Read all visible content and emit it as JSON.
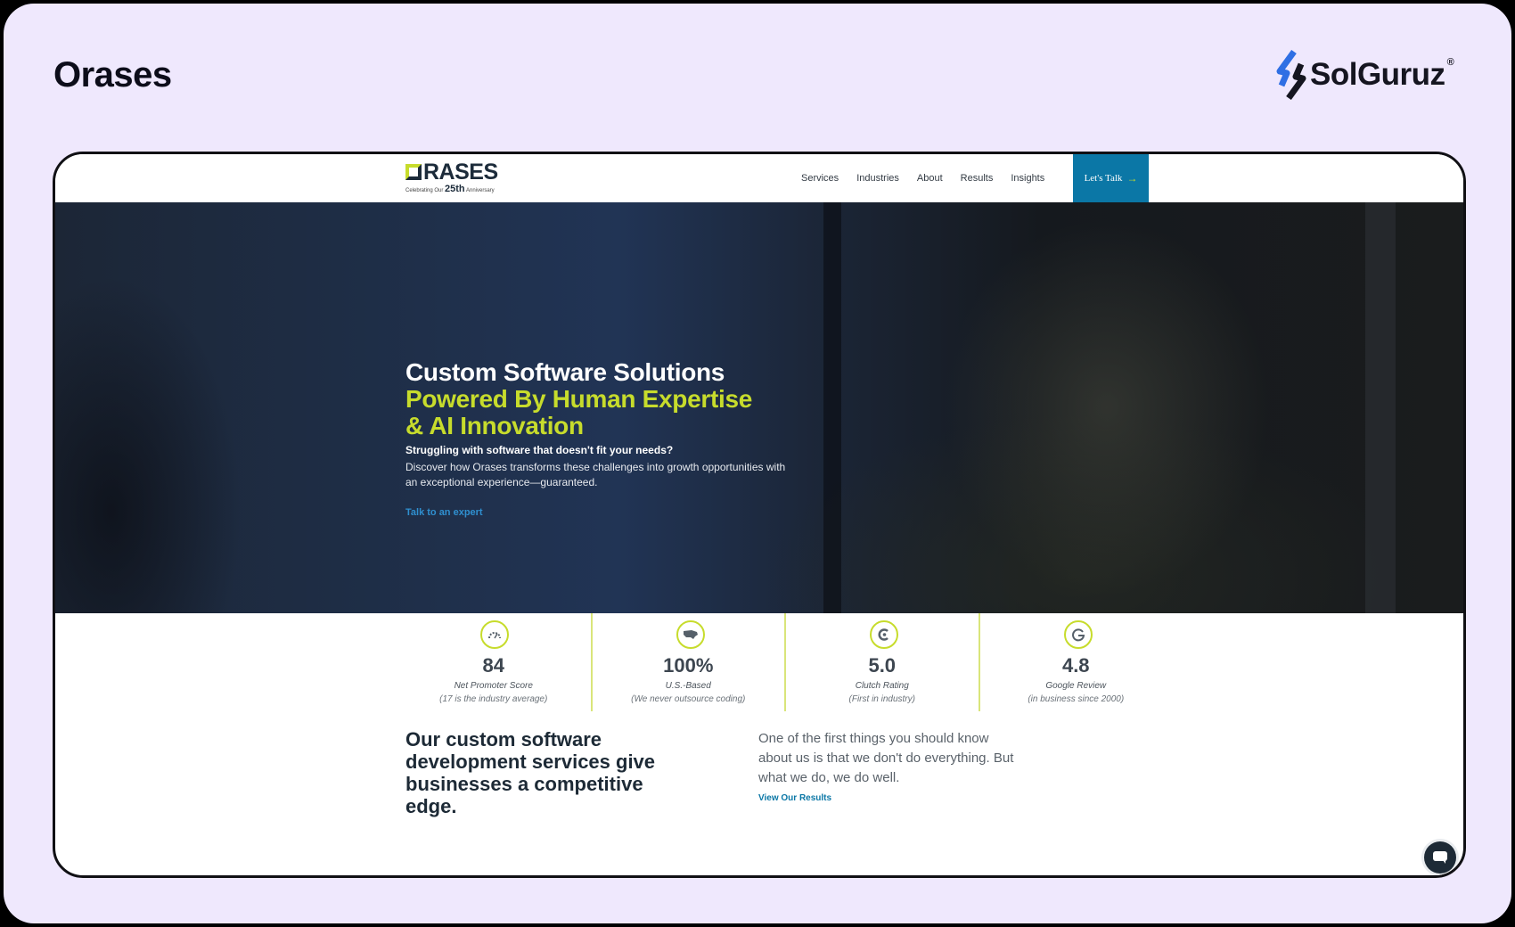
{
  "page": {
    "title": "Orases",
    "brand": {
      "name": "SolGuruz",
      "registered": "®"
    }
  },
  "site": {
    "logo": {
      "word": "RASES",
      "sub_prefix": "Celebrating Our",
      "sub_number": "25th",
      "sub_suffix": "Anniversary"
    },
    "nav": [
      {
        "label": "Services"
      },
      {
        "label": "Industries"
      },
      {
        "label": "About"
      },
      {
        "label": "Results"
      },
      {
        "label": "Insights"
      }
    ],
    "cta": {
      "label": "Let's Talk",
      "icon": "arrow-right-icon"
    }
  },
  "hero": {
    "heading_line1": "Custom Software Solutions",
    "heading_line2": "Powered By Human Expertise",
    "heading_line3": "& AI Innovation",
    "subheading": "Struggling with software that doesn't fit your needs?",
    "body": "Discover how Orases transforms these challenges into growth opportunities with an exceptional experience—guaranteed.",
    "link": "Talk to an expert"
  },
  "stats": [
    {
      "value": "84",
      "label": "Net Promoter Score",
      "note": "(17 is the industry average)",
      "icon": "gauge-icon"
    },
    {
      "value": "100%",
      "label": "U.S.-Based",
      "note": "(We never outsource coding)",
      "icon": "usa-map-icon"
    },
    {
      "value": "5.0",
      "label": "Clutch Rating",
      "note": "(First in industry)",
      "icon": "clutch-icon"
    },
    {
      "value": "4.8",
      "label": "Google Review",
      "note": "(in business since 2000)",
      "icon": "google-icon"
    }
  ],
  "services": {
    "heading": "Our custom software development services give businesses a competitive edge.",
    "text": "One of the first things you should know about us is that we don't do everything. But what we do, we do well.",
    "link": "View Our Results"
  },
  "colors": {
    "accent_lime": "#c7dc2c",
    "accent_blue": "#0b77a6",
    "frame_bg": "#efe8fd"
  }
}
